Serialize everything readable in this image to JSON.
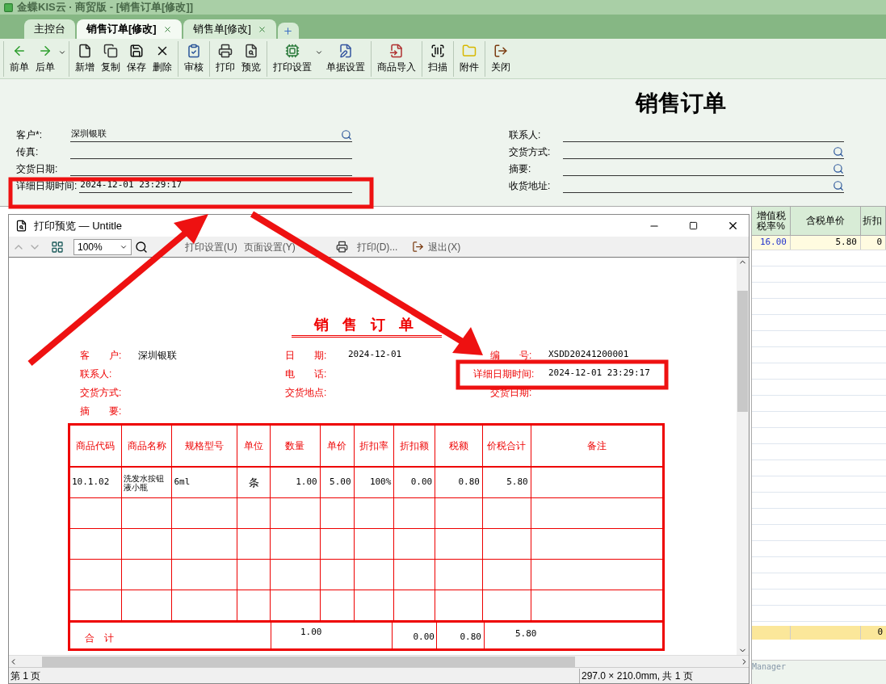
{
  "window": {
    "title": "金蝶KIS云 · 商贸版 - [销售订单[修改]]"
  },
  "tabs": [
    {
      "label": "主控台",
      "selected": false,
      "closable": false
    },
    {
      "label": "销售订单[修改]",
      "selected": true,
      "closable": true
    },
    {
      "label": "销售单[修改]",
      "selected": false,
      "closable": true
    }
  ],
  "toolbar": [
    [
      {
        "label": "前单",
        "dropdown": false
      },
      {
        "label": "后单",
        "dropdown": true
      }
    ],
    [
      {
        "label": "新增",
        "dropdown": false
      },
      {
        "label": "复制",
        "dropdown": false
      },
      {
        "label": "保存",
        "dropdown": false
      },
      {
        "label": "删除",
        "dropdown": false
      }
    ],
    [
      {
        "label": "审核",
        "dropdown": false
      }
    ],
    [
      {
        "label": "打印",
        "dropdown": false
      },
      {
        "label": "预览",
        "dropdown": false
      }
    ],
    [
      {
        "label": "打印设置",
        "dropdown": true
      },
      {
        "label": "单据设置",
        "dropdown": false
      }
    ],
    [
      {
        "label": "商品导入",
        "dropdown": false
      }
    ],
    [
      {
        "label": "扫描",
        "dropdown": false
      }
    ],
    [
      {
        "label": "附件",
        "dropdown": false
      }
    ],
    [
      {
        "label": "关闭",
        "dropdown": false
      }
    ]
  ],
  "form": {
    "title": "销售订单",
    "left_fields": [
      {
        "label": "客户*:",
        "value": "深圳银联",
        "lookup": true
      },
      {
        "label": "传真:",
        "lookup": false
      },
      {
        "label": "交货日期:",
        "lookup": false
      },
      {
        "label": "详细日期时间:",
        "value": "2024-12-01 23:29:17",
        "lookup": false
      }
    ],
    "right_fields": [
      {
        "label": "联系人:",
        "lookup": false
      },
      {
        "label": "交货方式:",
        "lookup": true
      },
      {
        "label": "摘要:",
        "lookup": true
      },
      {
        "label": "收货地址:",
        "lookup": true
      }
    ]
  },
  "grid": {
    "columns": [
      "增值税税率%",
      "含税单价",
      "折扣"
    ],
    "rows": [
      [
        "16.00",
        "5.80",
        "0"
      ]
    ],
    "totals": "0",
    "footer": "Manager"
  },
  "preview": {
    "title": "打印预览 — Untitle",
    "zoom": "100%",
    "toolbar": [
      "打印设置(U)",
      "页面设置(Y)",
      "打印(D)...",
      "退出(X)"
    ],
    "doc": {
      "title": "销 售 订 单",
      "field_columns": [
        [
          {
            "label": "客　　户:",
            "value": "深圳银联"
          },
          {
            "label": "联系人:"
          },
          {
            "label": "交货方式:"
          },
          {
            "label": "摘　　要:"
          }
        ],
        [
          {
            "label": "日　　期:",
            "value": "2024-12-01"
          },
          {
            "label": "电　　话:"
          },
          {
            "label": "交货地点:"
          }
        ],
        [
          {
            "label": "编　　号:",
            "value": "XSDD20241200001"
          },
          {
            "label": "详细日期时间:",
            "value": "2024-12-01 23:29:17"
          },
          {
            "label": "交货日期:"
          }
        ]
      ],
      "columns": [
        "商品代码",
        "商品名称",
        "规格型号",
        "单位",
        "数量",
        "单价",
        "折扣率",
        "折扣额",
        "税额",
        "价税合计",
        "备注"
      ],
      "rows": [
        [
          "10.1.02",
          "洗发水按钮液小瓶",
          "6ml",
          "条",
          "1.00",
          "5.00",
          "100%",
          "0.00",
          "0.80",
          "5.80"
        ]
      ],
      "totals": {
        "label": "合　计",
        "quantity": "1.00",
        "discount_amount": "0.00",
        "tax": "0.80",
        "total": "5.80"
      }
    },
    "status_left": "第 1 页",
    "status_right": "297.0 × 210.0mm, 共 1 页"
  }
}
